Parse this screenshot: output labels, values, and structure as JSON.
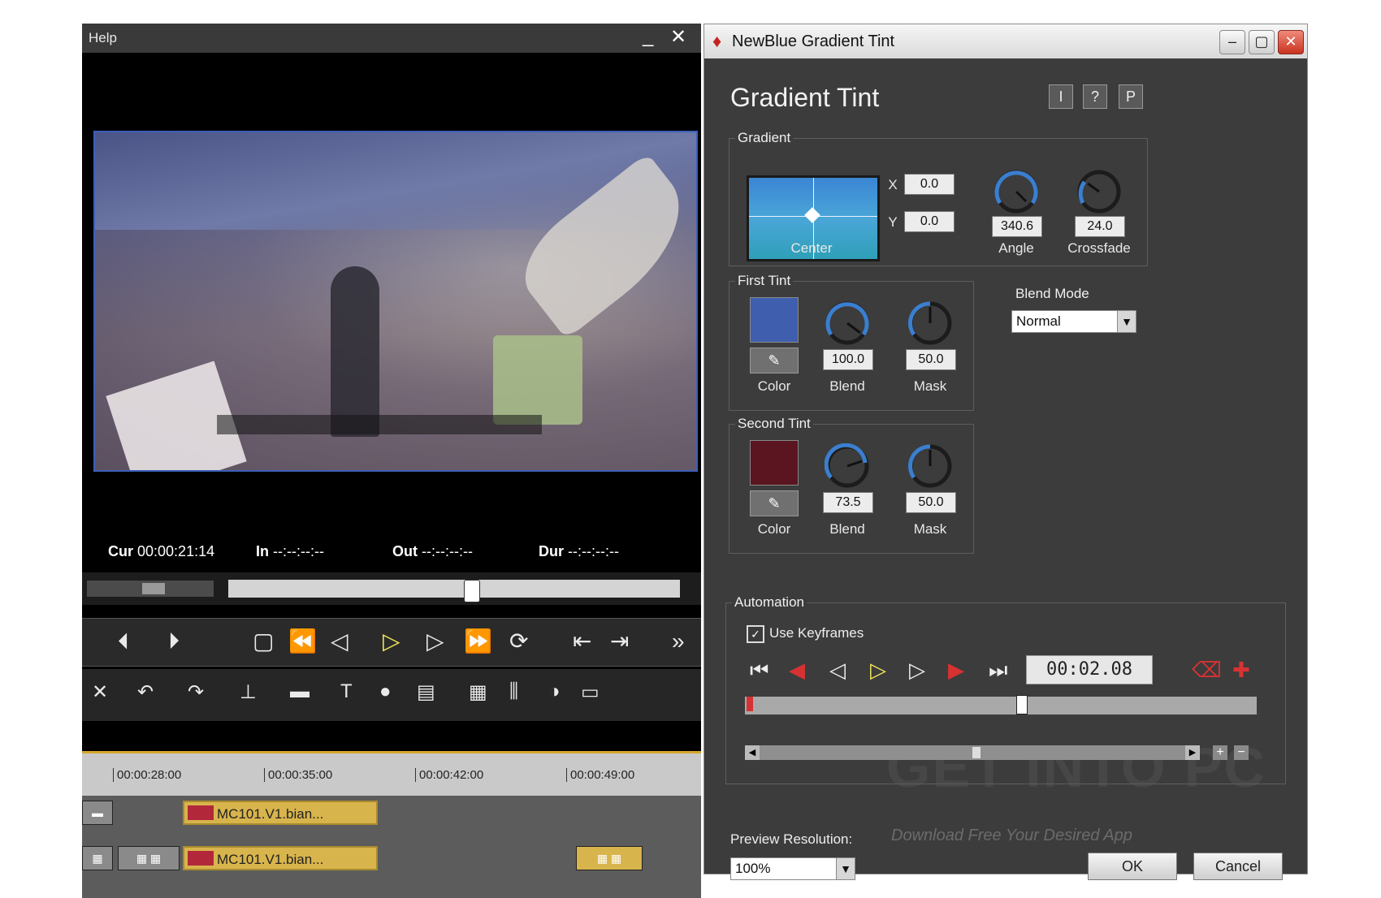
{
  "editor": {
    "title": "Help",
    "minimize": "_",
    "close": "✕",
    "timecodes": {
      "cur_label": "Cur",
      "cur": "00:00:21:14",
      "in_label": "In",
      "in": "--:--:--:--",
      "out_label": "Out",
      "out": "--:--:--:--",
      "dur_label": "Dur",
      "dur": "--:--:--:--"
    },
    "ruler": [
      "00:00:28:00",
      "00:00:35:00",
      "00:00:42:00",
      "00:00:49:00"
    ],
    "clips": [
      "MC101.V1.bian...",
      "MC101.V1.bian..."
    ]
  },
  "dialog": {
    "title": "NewBlue Gradient Tint",
    "heading": "Gradient Tint",
    "top_buttons": [
      "I",
      "?",
      "P"
    ],
    "gradient": {
      "label": "Gradient",
      "center_label": "Center",
      "x_label": "X",
      "x": "0.0",
      "y_label": "Y",
      "y": "0.0",
      "angle": "340.6",
      "angle_label": "Angle",
      "crossfade": "24.0",
      "crossfade_label": "Crossfade"
    },
    "first_tint": {
      "label": "First Tint",
      "color_label": "Color",
      "color": "#3f5fae",
      "blend": "100.0",
      "blend_label": "Blend",
      "mask": "50.0",
      "mask_label": "Mask"
    },
    "second_tint": {
      "label": "Second Tint",
      "color_label": "Color",
      "color": "#5a1520",
      "blend": "73.5",
      "blend_label": "Blend",
      "mask": "50.0",
      "mask_label": "Mask"
    },
    "blend_mode": {
      "label": "Blend Mode",
      "value": "Normal"
    },
    "automation": {
      "label": "Automation",
      "use_keyframes": "Use Keyframes",
      "time": "00:02.08"
    },
    "preview": {
      "label": "Preview Resolution:",
      "value": "100%"
    },
    "ok": "OK",
    "cancel": "Cancel",
    "watermark": "GET INTO PC",
    "watermark_sub": "Download Free Your Desired App"
  }
}
